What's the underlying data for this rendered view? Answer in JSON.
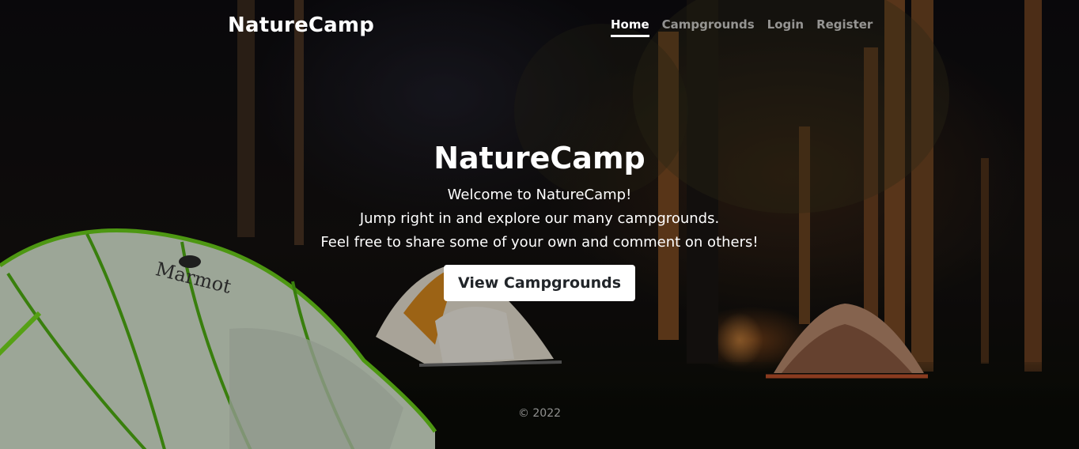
{
  "header": {
    "brand": "NatureCamp",
    "nav": [
      {
        "label": "Home",
        "active": true
      },
      {
        "label": "Campgrounds",
        "active": false
      },
      {
        "label": "Login",
        "active": false
      },
      {
        "label": "Register",
        "active": false
      }
    ]
  },
  "hero": {
    "title": "NatureCamp",
    "lines": [
      "Welcome to NatureCamp!",
      "Jump right in and explore our many campgrounds.",
      "Feel free to share some of your own and comment on others!"
    ],
    "cta_label": "View Campgrounds"
  },
  "footer": {
    "copyright": "© 2022"
  },
  "background": {
    "tent_brand": "Marmot"
  }
}
